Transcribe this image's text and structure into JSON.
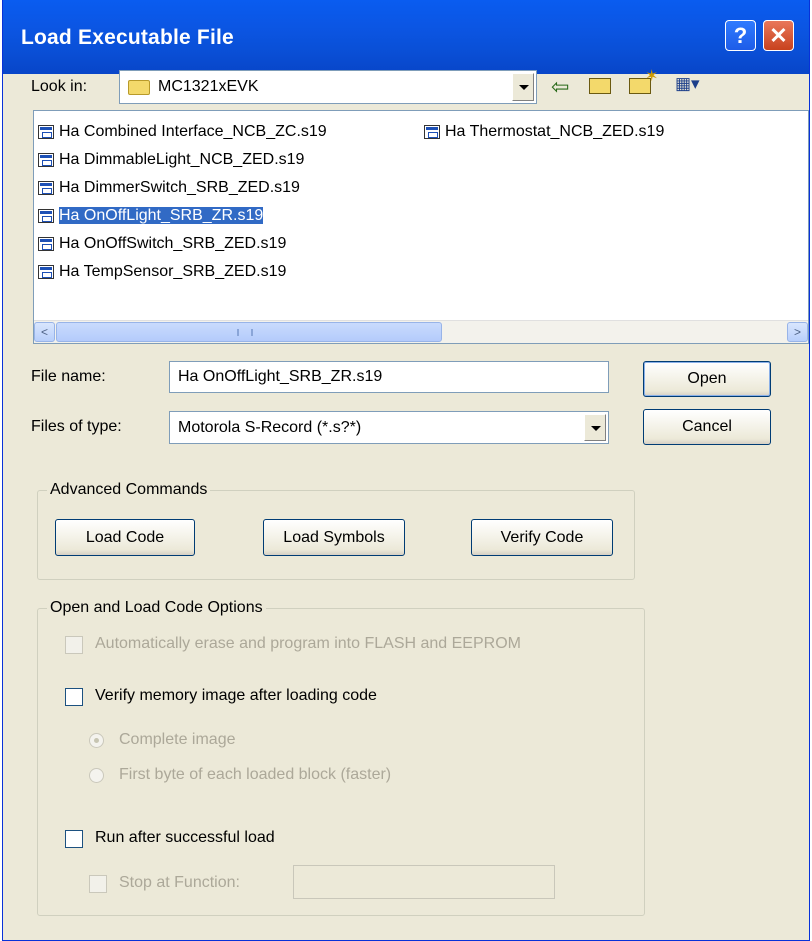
{
  "dialog": {
    "title": "Load Executable File",
    "help_glyph": "?",
    "close_glyph": "✕"
  },
  "look_in": {
    "label": "Look in:",
    "value": "MC1321xEVK"
  },
  "toolbar": {
    "back_glyph": "⇦",
    "up_glyph": "⮤",
    "new_glyph": "✶",
    "view_glyph": "▦▾"
  },
  "files": [
    "Ha Combined Interface_NCB_ZC.s19",
    "Ha DimmableLight_NCB_ZED.s19",
    "Ha DimmerSwitch_SRB_ZED.s19",
    "Ha OnOffLight_SRB_ZR.s19",
    "Ha OnOffSwitch_SRB_ZED.s19",
    "Ha TempSensor_SRB_ZED.s19",
    "Ha Thermostat_NCB_ZED.s19"
  ],
  "selected_file": "Ha OnOffLight_SRB_ZR.s19",
  "scroll": {
    "left_glyph": "<",
    "right_glyph": ">",
    "grip": "III"
  },
  "file_name": {
    "label": "File name:",
    "value": "Ha OnOffLight_SRB_ZR.s19"
  },
  "file_type": {
    "label": "Files of type:",
    "value": "Motorola S-Record (*.s?*)"
  },
  "buttons": {
    "open": "Open",
    "cancel": "Cancel"
  },
  "advanced": {
    "title": "Advanced Commands",
    "load_code": "Load Code",
    "load_symbols": "Load Symbols",
    "verify_code": "Verify Code"
  },
  "options": {
    "title": "Open and Load Code Options",
    "auto_erase": "Automatically erase and program into FLASH and EEPROM",
    "verify_memory": "Verify memory image after loading code",
    "complete_image": "Complete image",
    "first_byte": "First byte of each loaded block (faster)",
    "run_after": "Run after successful load",
    "stop_at": "Stop at Function:"
  }
}
